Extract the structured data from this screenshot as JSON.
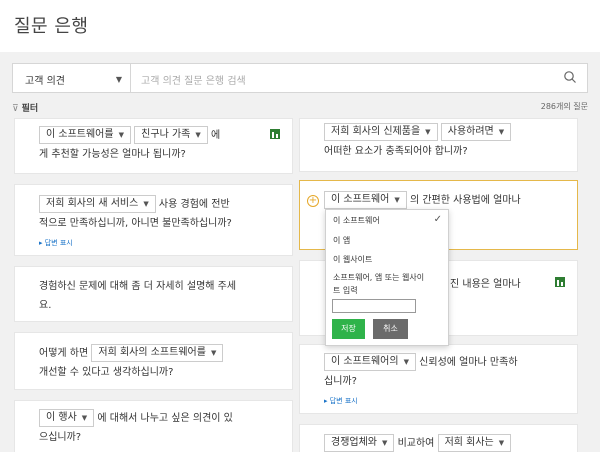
{
  "header": {
    "title": "질문 은행"
  },
  "search": {
    "category": "고객 의견",
    "placeholder": "고객 의견 질문 은행 검색"
  },
  "filter": {
    "label": "필터",
    "count": "286개의 질문"
  },
  "cards": {
    "c1": {
      "tok1": "이 소프트웨어를",
      "tok2": "친구나 가족",
      "t1": "에",
      "t2": "게 추천할 가능성은 얼마나 됩니까?"
    },
    "c2": {
      "tok1": "저희 회사의 새 서비스",
      "t1": "사용 경험에 전반",
      "t2": "적으로 만족하십니까, 아니면 불만족하십니까?",
      "ans": "▸ 답변 표시"
    },
    "c3": {
      "t1": "경험하신 문제에 대해 좀 더 자세히 설명해 주세",
      "t2": "요."
    },
    "c4": {
      "t0": "어떻게 하면",
      "tok1": "저희 회사의 소프트웨어를",
      "t2": "개선할 수 있다고 생각하십니까?"
    },
    "c5": {
      "tok1": "이 행사",
      "t1": "에 대해서 나누고 싶은 의견이 있",
      "t2": "으십니까?"
    },
    "c6": {
      "tok1": "저희 회사의 신제품을",
      "tok2": "사용하려면",
      "t2": "어떠한 요소가 충족되어야 합니까?"
    },
    "c7": {
      "tok1": "이 소프트웨어",
      "t1": "의 간편한 사용법에 얼마나"
    },
    "c8": {
      "t1": "진 내용은 얼마나"
    },
    "c9": {
      "tok1": "이 소프트웨어의",
      "t1": "신뢰성에 얼마나 만족하",
      "t2": "십니까?",
      "ans": "▸ 답변 표시"
    },
    "c10": {
      "tok1": "경쟁업체와",
      "t1": "비교하여",
      "tok2": "저희 회사는"
    }
  },
  "dropdown": {
    "options": [
      "이 소프트웨어",
      "이 앱",
      "이 웹사이트"
    ],
    "other_line1": "소프트웨어, 앱 또는 웹사이",
    "other_line2": "트 입력",
    "save": "저장",
    "cancel": "취소"
  },
  "colors": {
    "selected_border": "#e5b84a",
    "save_button": "#2fb34a",
    "cancel_button": "#6b6b6b",
    "link": "#1a73c8",
    "bar_icon": "#2e7d32"
  }
}
